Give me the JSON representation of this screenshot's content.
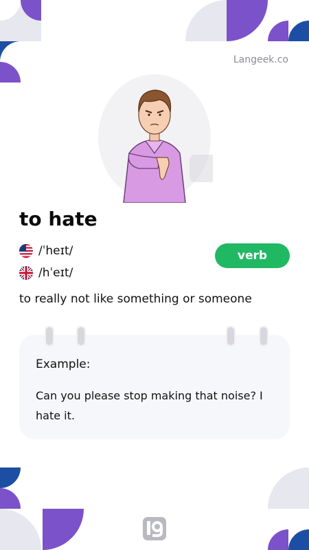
{
  "brand": "Langeek.co",
  "word": "to hate",
  "pronunciations": [
    {
      "flag": "us-flag-icon",
      "ipa": "/ˈheɪt/"
    },
    {
      "flag": "uk-flag-icon",
      "ipa": "/hˈeɪt/"
    }
  ],
  "part_of_speech": "verb",
  "definition": "to really not like something or someone",
  "example": {
    "label": "Example:",
    "text": "Can you please stop making that noise? I hate it."
  },
  "colors": {
    "accent_purple": "#7b52c9",
    "accent_blue": "#1c4fa4",
    "badge_green": "#21b864",
    "card_bg": "#f6f7fb"
  }
}
